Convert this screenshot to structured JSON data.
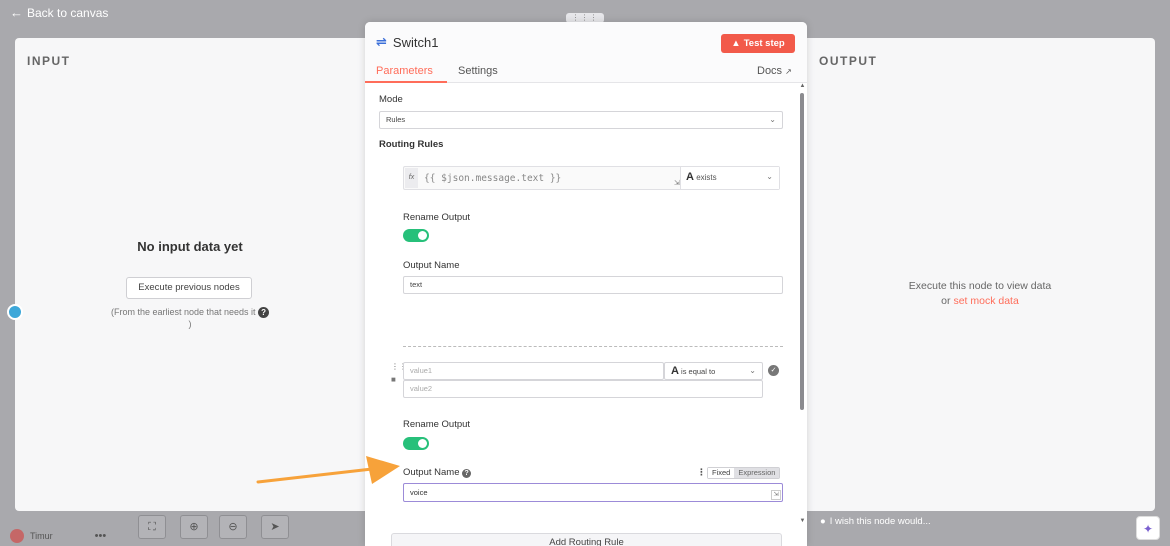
{
  "topbar": {
    "back_label": "Back to canvas"
  },
  "input_panel": {
    "title": "INPUT",
    "empty_title": "No input data yet",
    "execute_button": "Execute previous nodes",
    "hint": "(From the earliest node that needs it",
    "hint_end": ")"
  },
  "output_panel": {
    "title": "OUTPUT",
    "hint_line1": "Execute this node to view data",
    "hint_or": "or",
    "mock_link": "set mock data"
  },
  "node": {
    "title": "Switch1",
    "test_button": "Test step",
    "tabs": {
      "parameters": "Parameters",
      "settings": "Settings",
      "docs": "Docs"
    }
  },
  "params": {
    "mode_label": "Mode",
    "mode_value": "Rules",
    "routing_rules_label": "Routing Rules",
    "rule1": {
      "expression": "{{ $json.message.text }}",
      "operator": "exists",
      "rename_label": "Rename Output",
      "output_name_label": "Output Name",
      "output_name_value": "text"
    },
    "rule2": {
      "value1_placeholder": "value1",
      "value2_placeholder": "value2",
      "operator": "is equal to",
      "rename_label": "Rename Output",
      "output_name_label": "Output Name",
      "fixed_label": "Fixed",
      "expression_label": "Expression",
      "output_name_value": "voice"
    },
    "add_rule_button": "Add Routing Rule"
  },
  "bottom": {
    "user_name": "Timur",
    "wish_text": "I wish this node would..."
  },
  "colors": {
    "accent": "#ff6d5a",
    "toggle_on": "#27c07a",
    "annotation_arrow": "#f7a23a"
  }
}
